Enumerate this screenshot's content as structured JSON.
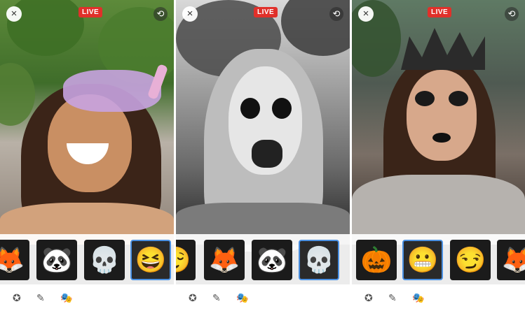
{
  "colors": {
    "live": "#e0302a",
    "selected": "#4a90e2"
  },
  "panels": [
    {
      "live_label": "LIVE",
      "close_icon": "×",
      "flip_icon": "⟲",
      "masks": [
        {
          "name": "fox-mask-icon",
          "glyph": "🦊"
        },
        {
          "name": "panda-mask-icon",
          "glyph": "🐼"
        },
        {
          "name": "skull-mask-icon",
          "glyph": "💀"
        },
        {
          "name": "unicorn-mask-icon",
          "glyph": "😆"
        }
      ],
      "selected_mask": "unicorn-mask-icon"
    },
    {
      "live_label": "LIVE",
      "close_icon": "×",
      "flip_icon": "⟲",
      "masks": [
        {
          "name": "witch-mask-icon",
          "glyph": "😌"
        },
        {
          "name": "fox-mask-icon",
          "glyph": "🦊"
        },
        {
          "name": "panda-mask-icon",
          "glyph": "🐼"
        },
        {
          "name": "skull-mask-icon",
          "glyph": "💀"
        }
      ],
      "selected_mask": "skull-mask-icon"
    },
    {
      "live_label": "LIVE",
      "close_icon": "×",
      "flip_icon": "⟲",
      "masks": [
        {
          "name": "pumpkin-mask-icon",
          "glyph": "🎃"
        },
        {
          "name": "queen-mask-icon",
          "glyph": "😬"
        },
        {
          "name": "witch-mask-icon",
          "glyph": "😏"
        },
        {
          "name": "fox-mask-icon",
          "glyph": "🦊"
        }
      ],
      "selected_mask": "queen-mask-icon"
    }
  ],
  "toolbar_icons": [
    "effects-icon",
    "pencil-icon",
    "masks-icon"
  ],
  "toolbar_glyphs": [
    "✪",
    "✎",
    "🎭"
  ]
}
